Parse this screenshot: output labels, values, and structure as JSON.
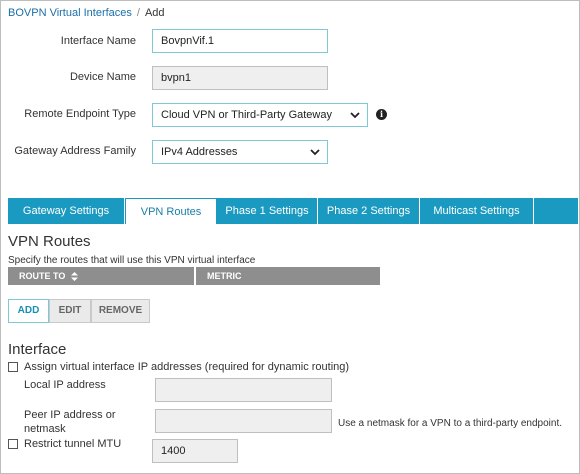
{
  "breadcrumb": {
    "parent": "BOVPN Virtual Interfaces",
    "separator": "/",
    "current": "Add"
  },
  "form": {
    "interface_name": {
      "label": "Interface Name",
      "value": "BovpnVif.1"
    },
    "device_name": {
      "label": "Device Name",
      "value": "bvpn1"
    },
    "remote_endpoint_type": {
      "label": "Remote Endpoint Type",
      "value": "Cloud VPN or Third-Party Gateway",
      "info_icon": "info-icon"
    },
    "gateway_address_family": {
      "label": "Gateway Address Family",
      "value": "IPv4 Addresses"
    }
  },
  "tabs": [
    {
      "label": "Gateway Settings",
      "active": false
    },
    {
      "label": "VPN Routes",
      "active": true
    },
    {
      "label": "Phase 1 Settings",
      "active": false
    },
    {
      "label": "Phase 2 Settings",
      "active": false
    },
    {
      "label": "Multicast Settings",
      "active": false
    }
  ],
  "vpn_routes": {
    "title": "VPN Routes",
    "description": "Specify the routes that will use this VPN virtual interface",
    "columns": [
      "ROUTE TO",
      "METRIC"
    ],
    "sort_icon": "sort-icon",
    "buttons": {
      "add": "ADD",
      "edit": "EDIT",
      "remove": "REMOVE"
    }
  },
  "interface": {
    "title": "Interface",
    "assign_checkbox": {
      "label": "Assign virtual interface IP addresses (required for dynamic routing)",
      "checked": false
    },
    "local_ip": {
      "label": "Local IP address",
      "value": ""
    },
    "peer_ip": {
      "label_line1": "Peer IP address or",
      "label_line2": "netmask",
      "value": "",
      "hint": "Use a netmask for a VPN to a third-party endpoint."
    },
    "restrict_mtu": {
      "label": "Restrict tunnel MTU",
      "checked": false,
      "value": "1400"
    }
  },
  "colors": {
    "accent": "#1a9ac0",
    "link": "#1a6fa8",
    "table_header": "#8e8e8e"
  }
}
